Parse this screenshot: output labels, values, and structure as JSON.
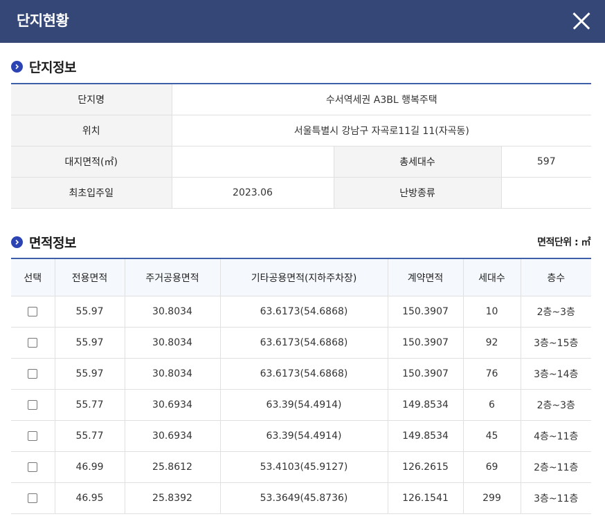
{
  "header": {
    "title": "단지현황"
  },
  "complex_section": {
    "title": "단지정보",
    "name_label": "단지명",
    "name_value": "수서역세권 A3BL 행복주택",
    "location_label": "위치",
    "location_value": "서울특별시 강남구 자곡로11길 11(자곡동)",
    "site_area_label": "대지면적(㎡)",
    "site_area_value": "",
    "households_label": "총세대수",
    "households_value": "597",
    "move_in_label": "최초입주일",
    "move_in_value": "2023.06",
    "heating_label": "난방종류",
    "heating_value": ""
  },
  "area_section": {
    "title": "면적정보",
    "unit_label": "면적단위 : ㎡",
    "columns": [
      "선택",
      "전용면적",
      "주거공용면적",
      "기타공용면적(지하주차장)",
      "계약면적",
      "세대수",
      "층수"
    ],
    "rows": [
      {
        "exclusive": "55.97",
        "residential_common": "30.8034",
        "other_common": "63.6173(54.6868)",
        "contract": "150.3907",
        "households": "10",
        "floors": "2층~3층"
      },
      {
        "exclusive": "55.97",
        "residential_common": "30.8034",
        "other_common": "63.6173(54.6868)",
        "contract": "150.3907",
        "households": "92",
        "floors": "3층~15층"
      },
      {
        "exclusive": "55.97",
        "residential_common": "30.8034",
        "other_common": "63.6173(54.6868)",
        "contract": "150.3907",
        "households": "76",
        "floors": "3층~14층"
      },
      {
        "exclusive": "55.77",
        "residential_common": "30.6934",
        "other_common": "63.39(54.4914)",
        "contract": "149.8534",
        "households": "6",
        "floors": "2층~3층"
      },
      {
        "exclusive": "55.77",
        "residential_common": "30.6934",
        "other_common": "63.39(54.4914)",
        "contract": "149.8534",
        "households": "45",
        "floors": "4층~11층"
      },
      {
        "exclusive": "46.99",
        "residential_common": "25.8612",
        "other_common": "53.4103(45.9127)",
        "contract": "126.2615",
        "households": "69",
        "floors": "2층~11층"
      },
      {
        "exclusive": "46.95",
        "residential_common": "25.8392",
        "other_common": "53.3649(45.8736)",
        "contract": "126.1541",
        "households": "299",
        "floors": "3층~11층"
      }
    ]
  },
  "colors": {
    "header_bg": "#344776",
    "accent_line": "#3d5fa8",
    "bullet": "#2c44b3"
  },
  "icons": {
    "close": "close-icon",
    "section_bullet": "chevron-right-circle-icon"
  }
}
